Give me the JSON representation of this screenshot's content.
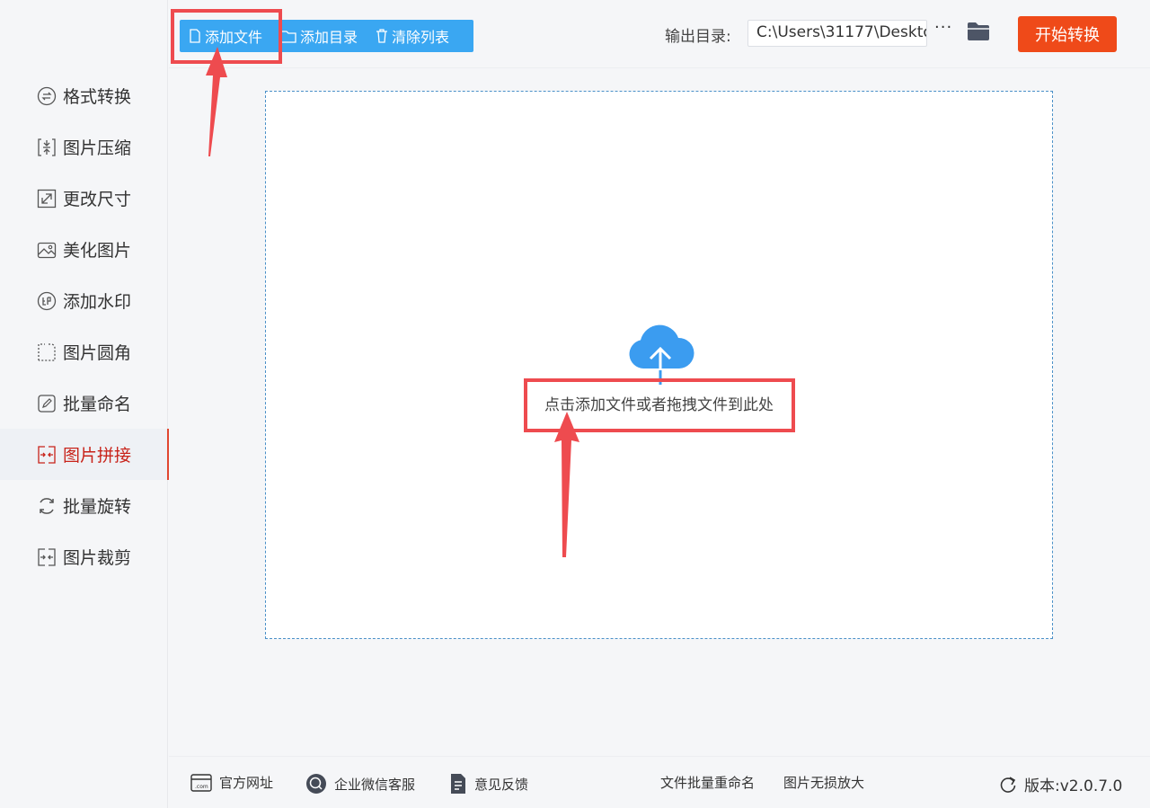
{
  "toolbar": {
    "add_file": "添加文件",
    "add_folder": "添加目录",
    "clear_list": "清除列表",
    "output_label": "输出目录:",
    "output_path": "C:\\Users\\31177\\Deskto",
    "more": "···",
    "start": "开始转换"
  },
  "sidebar": {
    "items": [
      {
        "label": "格式转换",
        "icon": "format-convert-icon"
      },
      {
        "label": "图片压缩",
        "icon": "compress-icon"
      },
      {
        "label": "更改尺寸",
        "icon": "resize-icon"
      },
      {
        "label": "美化图片",
        "icon": "beautify-icon"
      },
      {
        "label": "添加水印",
        "icon": "watermark-icon"
      },
      {
        "label": "图片圆角",
        "icon": "rounded-corner-icon"
      },
      {
        "label": "批量命名",
        "icon": "rename-icon"
      },
      {
        "label": "图片拼接",
        "icon": "splice-icon",
        "active": true
      },
      {
        "label": "批量旋转",
        "icon": "rotate-icon"
      },
      {
        "label": "图片裁剪",
        "icon": "crop-icon"
      }
    ]
  },
  "dropzone": {
    "text": "点击添加文件或者拖拽文件到此处"
  },
  "footer": {
    "website": "官方网址",
    "wechat": "企业微信客服",
    "feedback": "意见反馈",
    "batch_rename": "文件批量重命名",
    "lossless_enlarge": "图片无损放大",
    "version": "版本:v2.0.7.0"
  },
  "colors": {
    "accent_blue": "#3aa7f2",
    "start_orange": "#ef4a19",
    "annotation_red": "#ee4b4f",
    "active_text": "#c8231a"
  }
}
